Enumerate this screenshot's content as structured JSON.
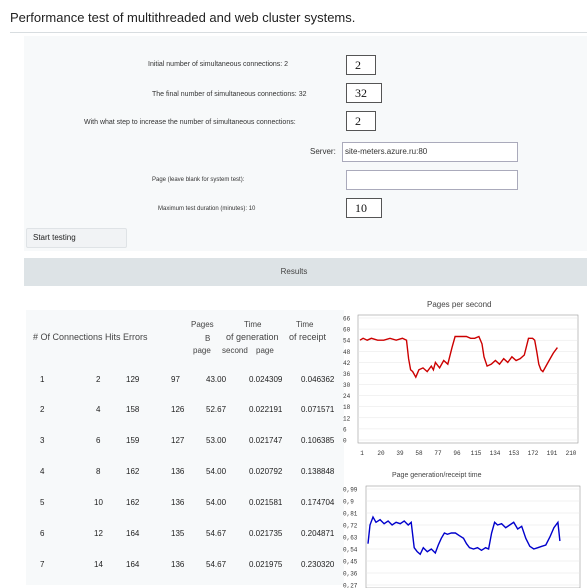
{
  "page": {
    "title": "Performance test of multithreaded and web cluster systems."
  },
  "form": {
    "initial_label": "Initial number of simultaneous connections: 2",
    "initial_value": "2",
    "final_label": "The final number of simultaneous connections: 32",
    "final_value": "32",
    "step_label": "With what step to increase the number of simultaneous connections:",
    "step_value": "2",
    "server_label": "Server:",
    "server_value": "site-meters.azure.ru:80",
    "page_label": "Page (leave blank for system test):",
    "page_value": "",
    "duration_label": "Maximum test duration (minutes): 10",
    "duration_value": "10",
    "start_button": "Start testing"
  },
  "results": {
    "header": "Results",
    "columns": {
      "connections_hits_errors": "# Of Connections Hits Errors",
      "pages_line1": "Pages",
      "pages_line2": "B",
      "pages_line3": "page",
      "time_gen_line1": "Time",
      "time_gen_line2": "of generation",
      "time_gen_line3": "second",
      "time_rec_line1": "Time",
      "time_rec_line2": "of receipt",
      "time_rec_line3": "page"
    },
    "rows": [
      {
        "n": "1",
        "conn": "2",
        "hits": "129",
        "err": "97",
        "pages": "43.00",
        "tgen": "0.024309",
        "trec": "0.046362"
      },
      {
        "n": "2",
        "conn": "4",
        "hits": "158",
        "err": "126",
        "pages": "52.67",
        "tgen": "0.022191",
        "trec": "0.071571"
      },
      {
        "n": "3",
        "conn": "6",
        "hits": "159",
        "err": "127",
        "pages": "53.00",
        "tgen": "0.021747",
        "trec": "0.106385"
      },
      {
        "n": "4",
        "conn": "8",
        "hits": "162",
        "err": "136",
        "pages": "54.00",
        "tgen": "0.020792",
        "trec": "0.138848"
      },
      {
        "n": "5",
        "conn": "10",
        "hits": "162",
        "err": "136",
        "pages": "54.00",
        "tgen": "0.021581",
        "trec": "0.174704"
      },
      {
        "n": "6",
        "conn": "12",
        "hits": "164",
        "err": "135",
        "pages": "54.67",
        "tgen": "0.021735",
        "trec": "0.204871"
      },
      {
        "n": "7",
        "conn": "14",
        "hits": "164",
        "err": "136",
        "pages": "54.67",
        "tgen": "0.021975",
        "trec": "0.230320"
      }
    ]
  },
  "chart_data": [
    {
      "type": "line",
      "title": "Pages per second",
      "yticks": [
        "66",
        "60",
        "54",
        "48",
        "42",
        "36",
        "30",
        "24",
        "18",
        "12",
        "6",
        "0"
      ],
      "xticks": [
        "1",
        "20",
        "39",
        "58",
        "77",
        "96",
        "115",
        "134",
        "153",
        "172",
        "191",
        "210"
      ],
      "ylim": [
        0,
        66
      ],
      "xlim": [
        1,
        210
      ],
      "color": "#cc0000",
      "series": [
        {
          "x": [
            1,
            4,
            8,
            12,
            18,
            24,
            30,
            36,
            42,
            46,
            48,
            50,
            52,
            55,
            58,
            62,
            66,
            70,
            72,
            74,
            78,
            82,
            86,
            90,
            93,
            96,
            100,
            104,
            108,
            112,
            116,
            119,
            121,
            124,
            128,
            132,
            136,
            140,
            144,
            148,
            152,
            156,
            160,
            164,
            168,
            170,
            172,
            174,
            176,
            178,
            180,
            184,
            188,
            192
          ],
          "y": [
            54,
            55,
            54,
            55,
            54,
            54,
            55,
            54,
            55,
            54,
            44,
            38,
            37,
            34,
            38,
            39,
            37,
            40,
            38,
            42,
            39,
            43,
            41,
            50,
            56,
            56,
            56,
            56,
            55,
            55,
            56,
            52,
            45,
            40,
            41,
            43,
            41,
            44,
            42,
            45,
            43,
            44,
            46,
            55,
            55,
            54,
            48,
            41,
            38,
            37,
            39,
            43,
            47,
            50
          ]
        }
      ]
    },
    {
      "type": "line",
      "title": "Page generation/receipt time",
      "yticks": [
        "0,99",
        "0,9",
        "0,81",
        "0,72",
        "0,63",
        "0,54",
        "0,45",
        "0,36",
        "0,27"
      ],
      "ylim": [
        0.27,
        0.99
      ],
      "xlim": [
        1,
        210
      ],
      "color": "#0000cc",
      "series": [
        {
          "x": [
            1,
            3,
            6,
            9,
            13,
            17,
            21,
            25,
            29,
            33,
            37,
            41,
            44,
            47,
            50,
            53,
            56,
            60,
            64,
            68,
            71,
            74,
            77,
            80,
            84,
            88,
            92,
            96,
            99,
            102,
            106,
            110,
            114,
            118,
            121,
            124,
            127,
            130,
            134,
            138,
            142,
            146,
            150,
            154,
            158,
            162,
            166,
            170,
            174,
            178,
            182,
            186,
            190,
            192
          ],
          "y": [
            0.58,
            0.72,
            0.78,
            0.74,
            0.76,
            0.73,
            0.75,
            0.72,
            0.74,
            0.73,
            0.75,
            0.72,
            0.74,
            0.55,
            0.52,
            0.5,
            0.55,
            0.52,
            0.54,
            0.51,
            0.57,
            0.62,
            0.66,
            0.65,
            0.66,
            0.66,
            0.64,
            0.62,
            0.58,
            0.55,
            0.54,
            0.55,
            0.53,
            0.55,
            0.54,
            0.66,
            0.74,
            0.72,
            0.73,
            0.7,
            0.72,
            0.74,
            0.69,
            0.71,
            0.62,
            0.56,
            0.54,
            0.55,
            0.56,
            0.57,
            0.63,
            0.7,
            0.74,
            0.6
          ]
        }
      ]
    }
  ]
}
